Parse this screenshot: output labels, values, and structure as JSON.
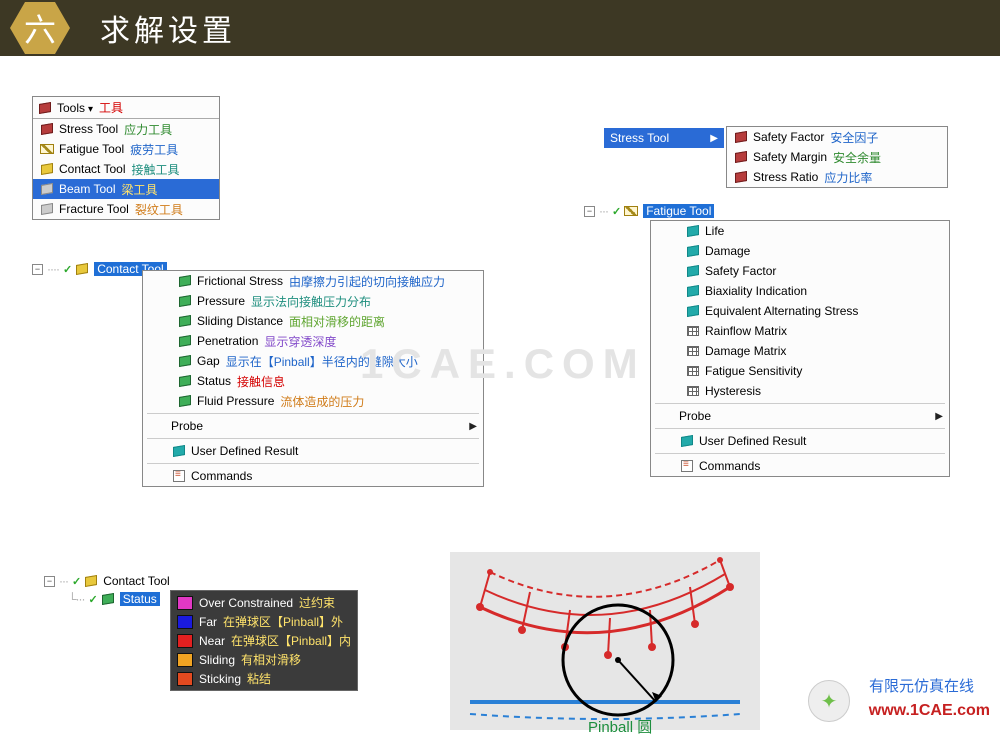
{
  "header": {
    "badge": "六",
    "title": "求解设置"
  },
  "tools_block": {
    "header_label": "Tools",
    "header_ann": "工具",
    "items": [
      {
        "label": "Stress Tool",
        "ann": "应力工具",
        "ann_class": "c-green"
      },
      {
        "label": "Fatigue Tool",
        "ann": "疲劳工具",
        "ann_class": "c-blue"
      },
      {
        "label": "Contact Tool",
        "ann": "接触工具",
        "ann_class": "c-teal"
      },
      {
        "label": "Beam Tool",
        "ann": "梁工具",
        "ann_class": "",
        "selected": true
      },
      {
        "label": "Fracture Tool",
        "ann": "裂纹工具",
        "ann_class": "c-orange"
      }
    ]
  },
  "contact_tree_label": "Contact Tool",
  "contact_menu": {
    "items": [
      {
        "label": "Frictional Stress",
        "ann": "由摩擦力引起的切向接触应力",
        "ann_class": "c-blue"
      },
      {
        "label": "Pressure",
        "ann": "显示法向接触压力分布",
        "ann_class": "c-teal"
      },
      {
        "label": "Sliding Distance",
        "ann": "面相对滑移的距离",
        "ann_class": "c-lime"
      },
      {
        "label": "Penetration",
        "ann": "显示穿透深度",
        "ann_class": "c-purple"
      },
      {
        "label": "Gap",
        "ann": "显示在【Pinball】半径内的缝隙大小",
        "ann_class": "c-blue"
      },
      {
        "label": "Status",
        "ann": "接触信息",
        "ann_class": "c-red"
      },
      {
        "label": "Fluid Pressure",
        "ann": "流体造成的压力",
        "ann_class": "c-orange"
      }
    ],
    "probe": "Probe",
    "udr": "User Defined Result",
    "cmds": "Commands"
  },
  "stress_header": "Stress Tool",
  "stress_flyout": {
    "items": [
      {
        "label": "Safety Factor",
        "ann": "安全因子"
      },
      {
        "label": "Safety Margin",
        "ann": "安全余量"
      },
      {
        "label": "Stress Ratio",
        "ann": "应力比率"
      }
    ]
  },
  "fatigue_tree_label": "Fatigue Tool",
  "fatigue_menu": {
    "items": [
      "Life",
      "Damage",
      "Safety Factor",
      "Biaxiality Indication",
      "Equivalent Alternating Stress",
      "Rainflow Matrix",
      "Damage Matrix",
      "Fatigue Sensitivity",
      "Hysteresis"
    ],
    "probe": "Probe",
    "udr": "User Defined Result",
    "cmds": "Commands"
  },
  "status_tree": {
    "parent": "Contact Tool",
    "child": "Status"
  },
  "status_legend": [
    {
      "color": "#e238c4",
      "label": "Over Constrained",
      "ann": "过约束"
    },
    {
      "color": "#1a1adf",
      "label": "Far",
      "ann": "在弹球区【Pinball】外"
    },
    {
      "color": "#e22020",
      "label": "Near",
      "ann": "在弹球区【Pinball】内"
    },
    {
      "color": "#f0a323",
      "label": "Sliding",
      "ann": "有相对滑移"
    },
    {
      "color": "#e24a20",
      "label": "Sticking",
      "ann": "粘结"
    }
  ],
  "diagram_caption": "Pinball 圆",
  "watermark": "1CAE.COM",
  "footer": {
    "cn": "有限元仿真在线",
    "url": "www.1CAE.com"
  }
}
